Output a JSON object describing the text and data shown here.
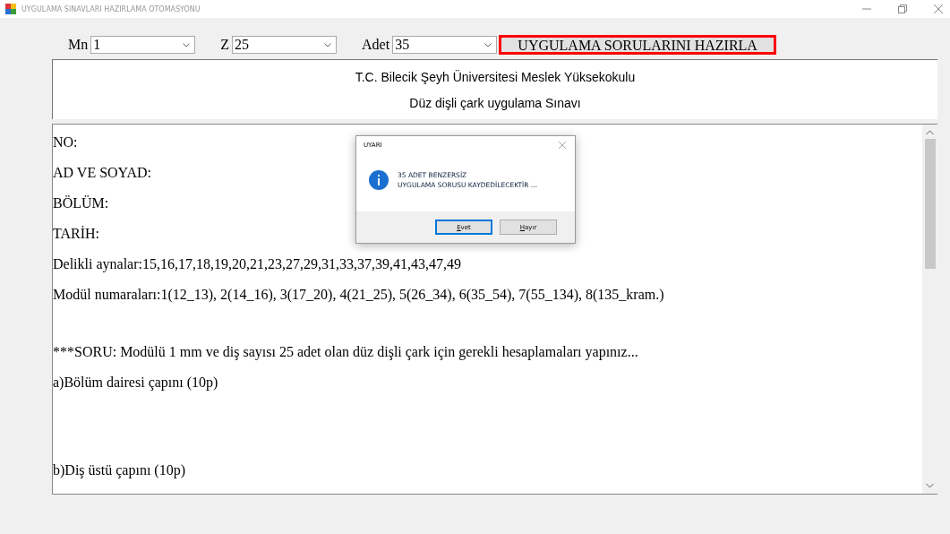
{
  "window": {
    "title": "UYGULAMA SINAVLARI HAZIRLAMA OTOMASYONU"
  },
  "toolbar": {
    "fields": [
      {
        "label": "Mn",
        "value": "1"
      },
      {
        "label": "Z",
        "value": "25"
      },
      {
        "label": "Adet",
        "value": "35"
      }
    ],
    "button": {
      "label": "UYGULAMA SORULARINI HAZIRLA",
      "focused": true
    }
  },
  "header": {
    "lines": [
      "T.C. Bilecik Şeyh Üniversitesi Meslek Yüksekokulu",
      "Düz dişli çark uygulama Sınavı"
    ]
  },
  "document": {
    "lines": [
      "NO:",
      "AD VE SOYAD:",
      "BÖLÜM:",
      "TARİH:",
      "Delikli aynalar:15,16,17,18,19,20,21,23,27,29,31,33,37,39,41,43,47,49",
      "Modül  numaraları:1(12_13), 2(14_16), 3(17_20), 4(21_25), 5(26_34), 6(35_54), 7(55_134), 8(135_kram.)"
    ],
    "question": "***SORU: Modülü 1 mm ve diş sayısı 25 adet olan düz dişli çark için gerekli hesaplamaları yapınız...",
    "parts": [
      "a)Bölüm dairesi çapını (10p)",
      "b)Diş üstü çapını (10p)"
    ]
  },
  "dialog": {
    "title": "UYARI",
    "lines": [
      "35 ADET BENZERSİZ",
      "UYGULAMA SORUSU KAYDEDİLECEKTİR ..."
    ],
    "buttons": [
      {
        "label": "Evet",
        "selected": true
      },
      {
        "label": "Hayır",
        "selected": false
      }
    ]
  }
}
